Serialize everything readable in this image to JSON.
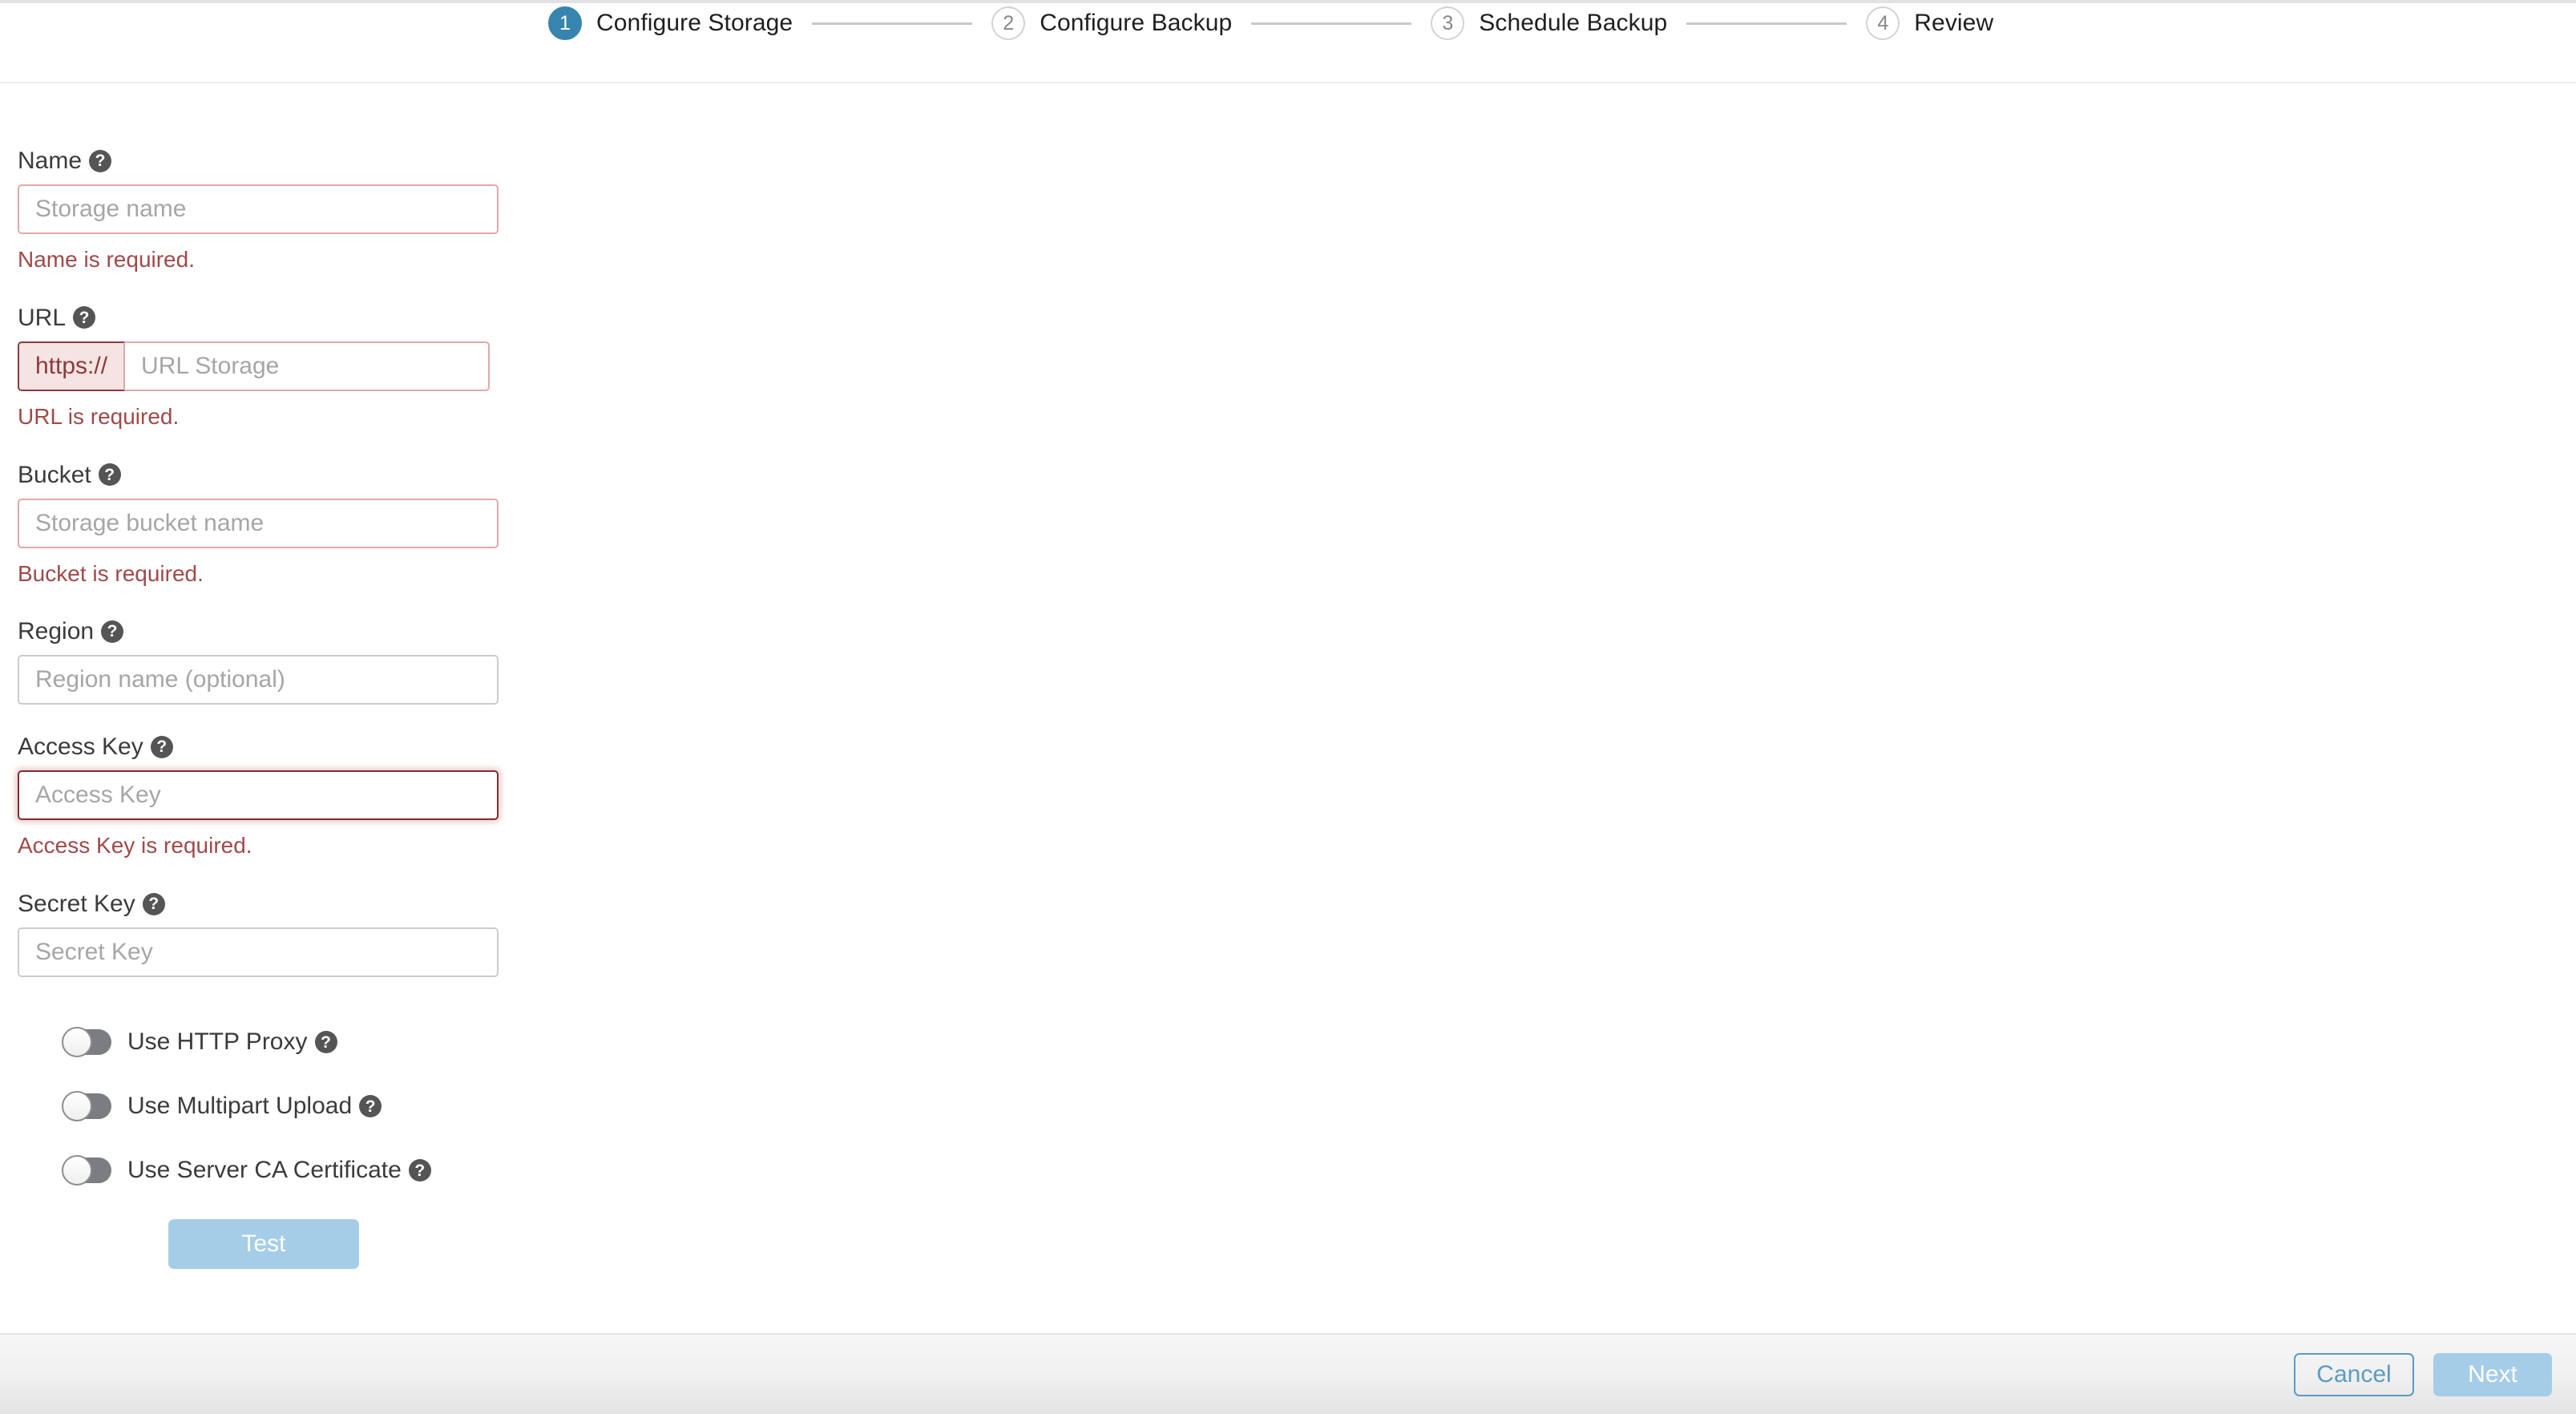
{
  "stepper": {
    "steps": [
      {
        "number": "1",
        "label": "Configure Storage",
        "state": "active"
      },
      {
        "number": "2",
        "label": "Configure Backup",
        "state": "inactive"
      },
      {
        "number": "3",
        "label": "Schedule Backup",
        "state": "inactive"
      },
      {
        "number": "4",
        "label": "Review",
        "state": "inactive"
      }
    ],
    "active_circle_color": "#3784ae",
    "inactive_circle_border": "#d3d3d3",
    "connector_color": "#c9c9c9"
  },
  "form": {
    "help_glyph": "?",
    "name": {
      "label": "Name",
      "placeholder": "Storage name",
      "value": "",
      "error": "Name is required."
    },
    "url": {
      "label": "URL",
      "prefix": "https://",
      "placeholder": "URL Storage",
      "value": "",
      "error": "URL is required."
    },
    "bucket": {
      "label": "Bucket",
      "placeholder": "Storage bucket name",
      "value": "",
      "error": "Bucket is required."
    },
    "region": {
      "label": "Region",
      "placeholder": "Region name (optional)",
      "value": ""
    },
    "access_key": {
      "label": "Access Key",
      "placeholder": "Access Key",
      "value": "",
      "error": "Access Key is required."
    },
    "secret_key": {
      "label": "Secret Key",
      "placeholder": "Secret Key",
      "value": ""
    },
    "toggles": [
      {
        "label": "Use HTTP Proxy",
        "on": false
      },
      {
        "label": "Use Multipart Upload",
        "on": false
      },
      {
        "label": "Use Server CA Certificate",
        "on": false
      }
    ],
    "test_button": "Test",
    "error_color": "#a1494a",
    "error_border_color": "#e3a8a8"
  },
  "footer": {
    "cancel_label": "Cancel",
    "next_label": "Next",
    "accent_color": "#5b9bc4",
    "disabled_color": "#a5cde8"
  }
}
